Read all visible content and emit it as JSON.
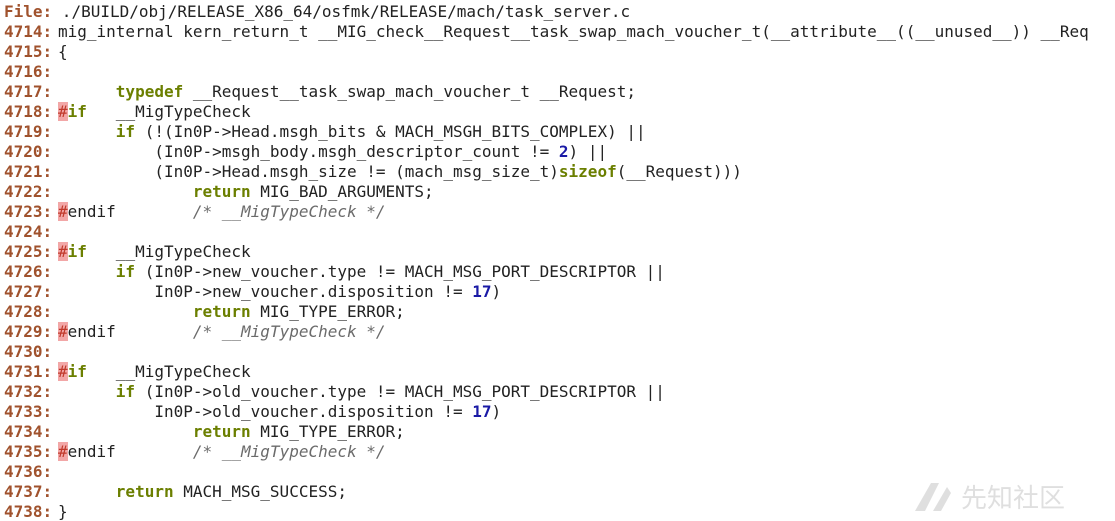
{
  "header": {
    "file_label": "File:",
    "file_path": " ./BUILD/obj/RELEASE_X86_64/osfmk/RELEASE/mach/task_server.c"
  },
  "colors": {
    "line_number": "#a0522d",
    "keyword": "#6b7f00",
    "number": "#1a1aa6",
    "comment": "#6b6b6b",
    "preprocessor_hash_bg": "#f2a7a7"
  },
  "lines": [
    {
      "n": "4714:",
      "parts": [
        {
          "t": "mig_internal kern_return_t __MIG_check__Request__task_swap_mach_voucher_t(__attribute__((__unused__)) __Req",
          "c": ""
        }
      ]
    },
    {
      "n": "4715:",
      "parts": [
        {
          "t": "{",
          "c": ""
        }
      ]
    },
    {
      "n": "4716:",
      "parts": []
    },
    {
      "n": "4717:",
      "parts": [
        {
          "t": "      ",
          "c": ""
        },
        {
          "t": "typedef",
          "c": "kw"
        },
        {
          "t": " __Request__task_swap_mach_voucher_t __Request;",
          "c": ""
        }
      ]
    },
    {
      "n": "4718:",
      "parts": [
        {
          "t": "#",
          "c": "pp-hash"
        },
        {
          "t": "if",
          "c": "pp-word"
        },
        {
          "t": "   __MigTypeCheck",
          "c": ""
        }
      ]
    },
    {
      "n": "4719:",
      "parts": [
        {
          "t": "      ",
          "c": ""
        },
        {
          "t": "if",
          "c": "kw"
        },
        {
          "t": " (!(In0P->Head.msgh_bits & MACH_MSGH_BITS_COMPLEX) ||",
          "c": ""
        }
      ]
    },
    {
      "n": "4720:",
      "parts": [
        {
          "t": "          (In0P->msgh_body.msgh_descriptor_count != ",
          "c": ""
        },
        {
          "t": "2",
          "c": "num"
        },
        {
          "t": ") ||",
          "c": ""
        }
      ]
    },
    {
      "n": "4721:",
      "parts": [
        {
          "t": "          (In0P->Head.msgh_size != (mach_msg_size_t)",
          "c": ""
        },
        {
          "t": "sizeof",
          "c": "kw"
        },
        {
          "t": "(__Request)))",
          "c": ""
        }
      ]
    },
    {
      "n": "4722:",
      "parts": [
        {
          "t": "              ",
          "c": ""
        },
        {
          "t": "return",
          "c": "kw"
        },
        {
          "t": " MIG_BAD_ARGUMENTS;",
          "c": ""
        }
      ]
    },
    {
      "n": "4723:",
      "parts": [
        {
          "t": "#",
          "c": "pp-hash"
        },
        {
          "t": "endif",
          "c": ""
        },
        {
          "t": "        ",
          "c": ""
        },
        {
          "t": "/* __MigTypeCheck */",
          "c": "cmt"
        }
      ]
    },
    {
      "n": "4724:",
      "parts": []
    },
    {
      "n": "4725:",
      "parts": [
        {
          "t": "#",
          "c": "pp-hash"
        },
        {
          "t": "if",
          "c": "pp-word"
        },
        {
          "t": "   __MigTypeCheck",
          "c": ""
        }
      ]
    },
    {
      "n": "4726:",
      "parts": [
        {
          "t": "      ",
          "c": ""
        },
        {
          "t": "if",
          "c": "kw"
        },
        {
          "t": " (In0P->new_voucher.type != MACH_MSG_PORT_DESCRIPTOR ||",
          "c": ""
        }
      ]
    },
    {
      "n": "4727:",
      "parts": [
        {
          "t": "          In0P->new_voucher.disposition != ",
          "c": ""
        },
        {
          "t": "17",
          "c": "num"
        },
        {
          "t": ")",
          "c": ""
        }
      ]
    },
    {
      "n": "4728:",
      "parts": [
        {
          "t": "              ",
          "c": ""
        },
        {
          "t": "return",
          "c": "kw"
        },
        {
          "t": " MIG_TYPE_ERROR;",
          "c": ""
        }
      ]
    },
    {
      "n": "4729:",
      "parts": [
        {
          "t": "#",
          "c": "pp-hash"
        },
        {
          "t": "endif",
          "c": ""
        },
        {
          "t": "        ",
          "c": ""
        },
        {
          "t": "/* __MigTypeCheck */",
          "c": "cmt"
        }
      ]
    },
    {
      "n": "4730:",
      "parts": []
    },
    {
      "n": "4731:",
      "parts": [
        {
          "t": "#",
          "c": "pp-hash"
        },
        {
          "t": "if",
          "c": "pp-word"
        },
        {
          "t": "   __MigTypeCheck",
          "c": ""
        }
      ]
    },
    {
      "n": "4732:",
      "parts": [
        {
          "t": "      ",
          "c": ""
        },
        {
          "t": "if",
          "c": "kw"
        },
        {
          "t": " (In0P->old_voucher.type != MACH_MSG_PORT_DESCRIPTOR ||",
          "c": ""
        }
      ]
    },
    {
      "n": "4733:",
      "parts": [
        {
          "t": "          In0P->old_voucher.disposition != ",
          "c": ""
        },
        {
          "t": "17",
          "c": "num"
        },
        {
          "t": ")",
          "c": ""
        }
      ]
    },
    {
      "n": "4734:",
      "parts": [
        {
          "t": "              ",
          "c": ""
        },
        {
          "t": "return",
          "c": "kw"
        },
        {
          "t": " MIG_TYPE_ERROR;",
          "c": ""
        }
      ]
    },
    {
      "n": "4735:",
      "parts": [
        {
          "t": "#",
          "c": "pp-hash"
        },
        {
          "t": "endif",
          "c": ""
        },
        {
          "t": "        ",
          "c": ""
        },
        {
          "t": "/* __MigTypeCheck */",
          "c": "cmt"
        }
      ]
    },
    {
      "n": "4736:",
      "parts": []
    },
    {
      "n": "4737:",
      "parts": [
        {
          "t": "      ",
          "c": ""
        },
        {
          "t": "return",
          "c": "kw"
        },
        {
          "t": " MACH_MSG_SUCCESS;",
          "c": ""
        }
      ]
    },
    {
      "n": "4738:",
      "parts": [
        {
          "t": "}",
          "c": ""
        }
      ]
    }
  ],
  "watermark": {
    "icon": "site-logo-icon",
    "text": "先知社区"
  }
}
